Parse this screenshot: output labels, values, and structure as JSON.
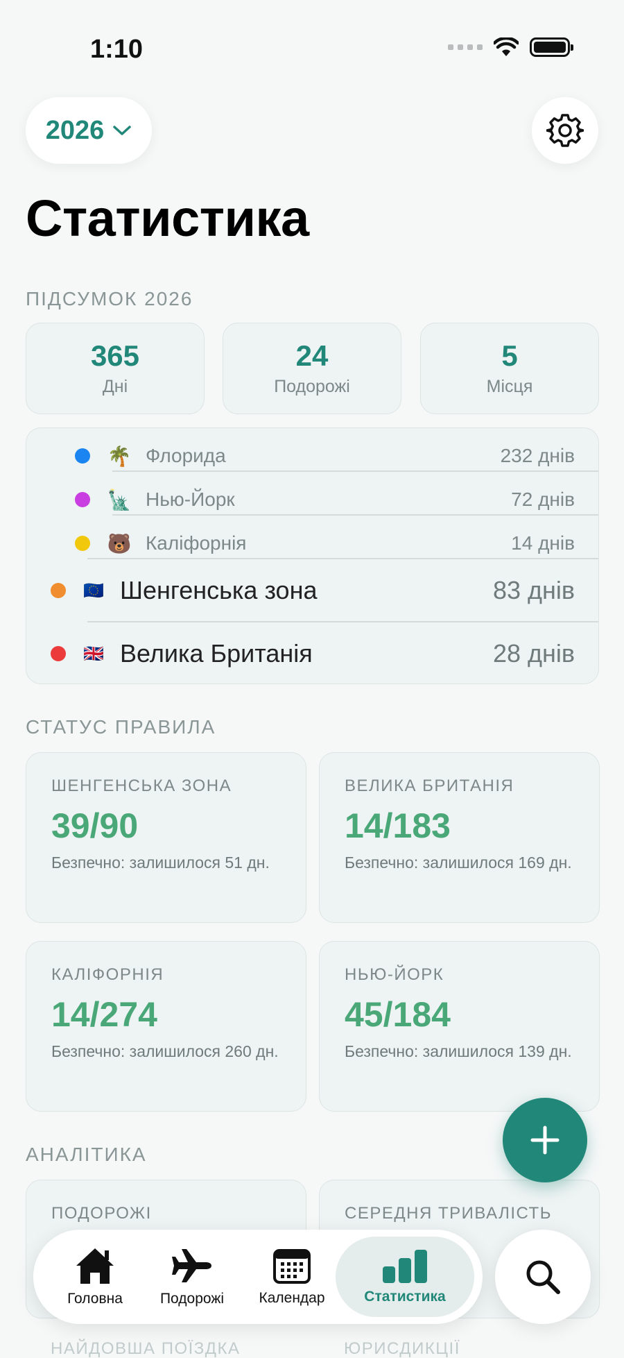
{
  "status_bar": {
    "time": "1:10"
  },
  "header": {
    "year": "2026",
    "title": "Статистика"
  },
  "summary": {
    "section_title": "ПІДСУМОК 2026",
    "cards": [
      {
        "value": "365",
        "label": "Дні"
      },
      {
        "value": "24",
        "label": "Подорожі"
      },
      {
        "value": "5",
        "label": "Місця"
      }
    ]
  },
  "places": [
    {
      "dot_color": "#1a84f0",
      "emoji": "🌴",
      "name": "Флорида",
      "days": "232 днів"
    },
    {
      "dot_color": "#c93ee0",
      "emoji": "🗽",
      "name": "Нью-Йорк",
      "days": "72 днів"
    },
    {
      "dot_color": "#f2c80c",
      "emoji": "🐻",
      "name": "Каліфорнія",
      "days": "14 днів"
    },
    {
      "dot_color": "#f08d2f",
      "emoji": "🇪🇺",
      "name": "Шенгенська зона",
      "days": "83 днів"
    },
    {
      "dot_color": "#ec3b3b",
      "emoji": "🇬🇧",
      "name": "Велика Британія",
      "days": "28 днів"
    }
  ],
  "rules": {
    "section_title": "СТАТУС ПРАВИЛА",
    "cards": [
      {
        "title": "ШЕНГЕНСЬКА ЗОНА",
        "value": "39/90",
        "subtitle": "Безпечно: залишилося 51 дн."
      },
      {
        "title": "ВЕЛИКА БРИТАНІЯ",
        "value": "14/183",
        "subtitle": "Безпечно: залишилося 169 дн."
      },
      {
        "title": "КАЛІФОРНІЯ",
        "value": "14/274",
        "subtitle": "Безпечно: залишилося 260 дн."
      },
      {
        "title": "НЬЮ-ЙОРК",
        "value": "45/184",
        "subtitle": "Безпечно: залишилося 139 дн."
      }
    ]
  },
  "analytics": {
    "section_title": "АНАЛІТИКА",
    "cards": [
      {
        "title": "ПОДОРОЖІ"
      },
      {
        "title": "СЕРЕДНЯ ТРИВАЛІСТЬ"
      }
    ],
    "bottom_labels": [
      "НАЙДОВША ПОЇЗДКА",
      "ЮРИСДИКЦІЇ"
    ]
  },
  "tab_bar": {
    "tabs": [
      {
        "label": "Головна",
        "icon": "home-icon"
      },
      {
        "label": "Подорожі",
        "icon": "airplane-icon"
      },
      {
        "label": "Календар",
        "icon": "calendar-icon"
      },
      {
        "label": "Статистика",
        "icon": "bar-chart-icon"
      }
    ],
    "active": "Статистика"
  },
  "colors": {
    "accent": "#218779",
    "safe_green": "#4aa878"
  }
}
